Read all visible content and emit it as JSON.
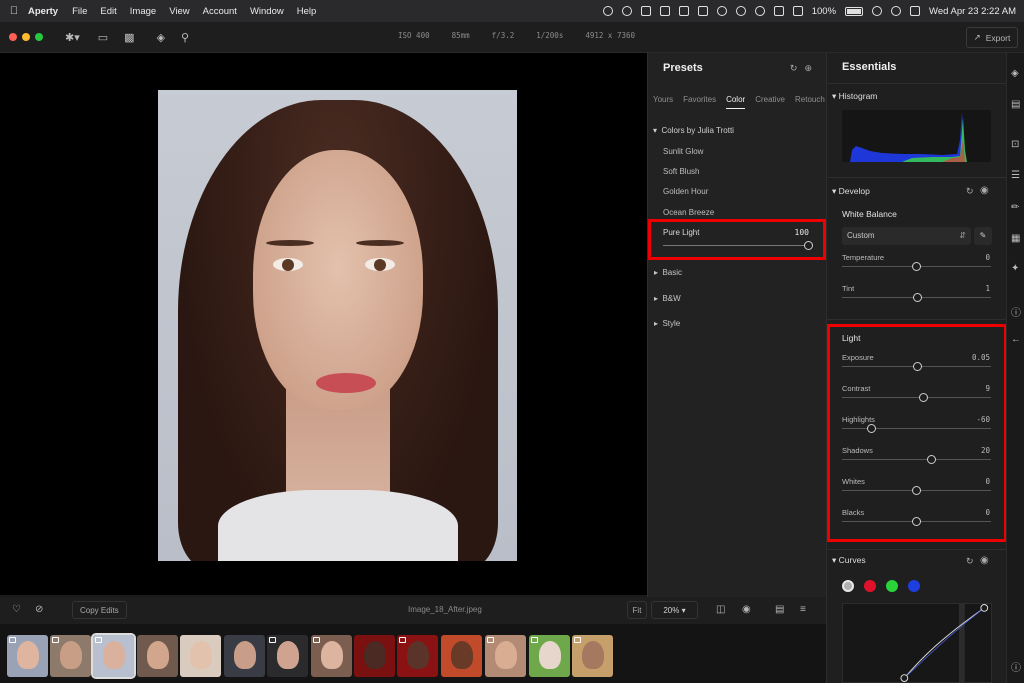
{
  "menubar": {
    "app_name": "Aperty",
    "menus": [
      "File",
      "Edit",
      "Image",
      "View",
      "Account",
      "Window",
      "Help"
    ],
    "battery": "100%",
    "clock": "Wed Apr 23  2:22 AM"
  },
  "toolbar": {
    "exif": [
      "ISO 400",
      "85mm",
      "f/3.2",
      "1/200s",
      "4912 x 7360"
    ],
    "export_label": "Export"
  },
  "bottombar": {
    "copy_edits": "Copy Edits",
    "filename": "Image_18_After.jpeg",
    "fit": "Fit",
    "zoom": "20%"
  },
  "presets": {
    "title": "Presets",
    "tabs": [
      "Yours",
      "Favorites",
      "Color",
      "Creative",
      "Retouch"
    ],
    "active_tab": "Color",
    "group_title": "Colors by Julia Trotti",
    "items": [
      "Sunlit Glow",
      "Soft Blush",
      "Golden Hour",
      "Ocean Breeze"
    ],
    "selected": {
      "label": "Pure Light",
      "value": "100",
      "amount": 1.0
    },
    "categories": [
      "Basic",
      "B&W",
      "Style"
    ]
  },
  "essentials": {
    "title": "Essentials",
    "histogram_title": "Histogram",
    "develop_title": "Develop",
    "white_balance": {
      "title": "White Balance",
      "preset": "Custom",
      "controls": [
        {
          "label": "Temperature",
          "value": "0",
          "pos": 0.5
        },
        {
          "label": "Tint",
          "value": "1",
          "pos": 0.51
        }
      ]
    },
    "light": {
      "title": "Light",
      "controls": [
        {
          "label": "Exposure",
          "value": "0.05",
          "pos": 0.51
        },
        {
          "label": "Contrast",
          "value": "9",
          "pos": 0.55
        },
        {
          "label": "Highlights",
          "value": "-60",
          "pos": 0.2
        },
        {
          "label": "Shadows",
          "value": "20",
          "pos": 0.6
        },
        {
          "label": "Whites",
          "value": "0",
          "pos": 0.5
        },
        {
          "label": "Blacks",
          "value": "0",
          "pos": 0.5
        }
      ]
    },
    "curves_title": "Curves",
    "curve_channels": [
      "#b0b0b0",
      "#e0122a",
      "#2bd33a",
      "#1f3ee0"
    ]
  },
  "colors": {
    "highlight_box": "#ee0000",
    "histogram_blue": "#1e37d8",
    "histogram_green": "#3ad04a"
  }
}
